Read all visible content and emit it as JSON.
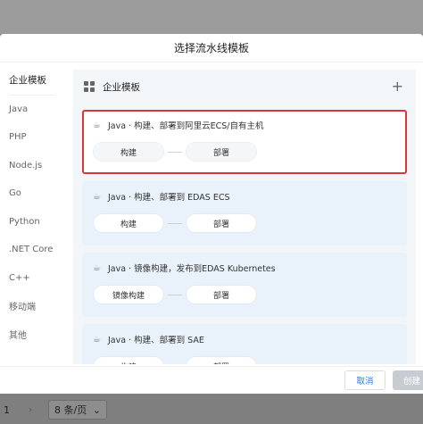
{
  "modal": {
    "title": "选择流水线模板",
    "sidebar": [
      {
        "label": "企业模板",
        "active": true
      },
      {
        "label": "Java"
      },
      {
        "label": "PHP"
      },
      {
        "label": "Node.js"
      },
      {
        "label": "Go"
      },
      {
        "label": "Python"
      },
      {
        "label": ".NET Core"
      },
      {
        "label": "C++"
      },
      {
        "label": "移动端"
      },
      {
        "label": "其他"
      }
    ],
    "content_header": {
      "title": "企业模板",
      "add_icon": "plus-icon"
    },
    "templates": [
      {
        "title": "Java · 构建、部署到阿里云ECS/自有主机",
        "stages": [
          "构建",
          "部署"
        ],
        "selected": true
      },
      {
        "title": "Java · 构建、部署到 EDAS ECS",
        "stages": [
          "构建",
          "部署"
        ]
      },
      {
        "title": "Java · 镜像构建，发布到EDAS Kubernetes",
        "stages": [
          "镜像构建",
          "部署"
        ]
      },
      {
        "title": "Java · 构建、部署到 SAE",
        "stages": [
          "构建",
          "部署"
        ]
      }
    ],
    "footer": {
      "cancel_label": "取消",
      "confirm_label": "创建"
    }
  },
  "pager": {
    "page": "1",
    "page_size": "8 条/页"
  },
  "colors": {
    "selected_border": "#d93636",
    "card_bg": "#e9f1fb",
    "link": "#2f7ad6"
  }
}
